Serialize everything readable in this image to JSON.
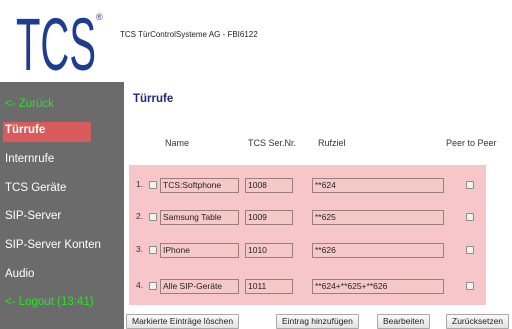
{
  "header": {
    "logo_text": "TCS",
    "registered_mark": "®",
    "device_title": "TCS TürControlSysteme AG - FBI6122"
  },
  "sidebar": {
    "items": [
      {
        "label": "<- Zurück"
      },
      {
        "label": "Türrufe",
        "active": true
      },
      {
        "label": "Internrufe"
      },
      {
        "label": "TCS Geräte"
      },
      {
        "label": "SIP-Server"
      },
      {
        "label": "SIP-Server Konten"
      },
      {
        "label": "Audio"
      },
      {
        "label": "<- Logout (13:41)"
      }
    ]
  },
  "main": {
    "title": "Türrufe",
    "columns": {
      "name": "Name",
      "serial": "TCS Ser.Nr.",
      "target": "Rufziel",
      "peer": "Peer to Peer"
    },
    "rows": [
      {
        "num": "1.",
        "name": "TCS:Softphone",
        "serial": "1008",
        "target": "**624"
      },
      {
        "num": "2.",
        "name": "Samsung Table",
        "serial": "1009",
        "target": "**625"
      },
      {
        "num": "3.",
        "name": "IPhone",
        "serial": "1010",
        "target": "**626"
      },
      {
        "num": "4.",
        "name": "Alle SIP-Geräte",
        "serial": "1011",
        "target": "**624+**625+**626"
      }
    ]
  },
  "footer": {
    "delete_label": "Markierte Einträge löschen",
    "add_label": "Eintrag hinzufügen",
    "edit_label": "Bearbeiten",
    "reset_label": "Zurücksetzen"
  },
  "colors": {
    "sidebar_bg": "#6b6b6b",
    "active_nav": "#d85a5a",
    "nav_green": "#2ee02e",
    "table_bg": "#f6c6c8",
    "title_color": "#1e2a78"
  }
}
